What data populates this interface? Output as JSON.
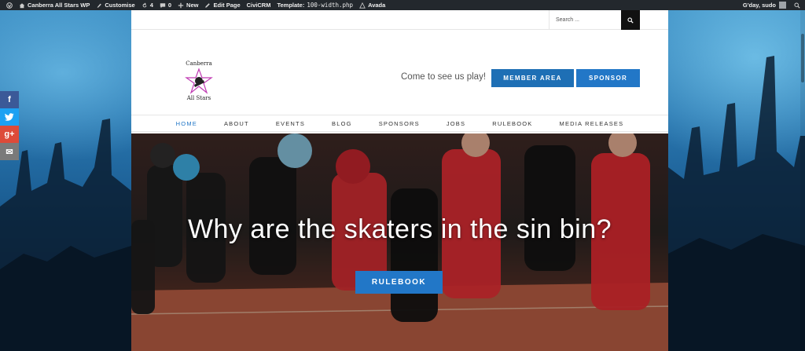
{
  "adminbar": {
    "site_name": "Canberra All Stars WP",
    "customise": "Customise",
    "updates_count": "4",
    "comments_count": "0",
    "new_label": "New",
    "edit_page": "Edit Page",
    "civicrm": "CiviCRM",
    "template_label": "Template:",
    "template_file": "100-width.php",
    "theme": "Avada",
    "greeting": "G'day, sudo"
  },
  "search": {
    "placeholder": "Search ..."
  },
  "header": {
    "logo_text_top": "Canberra",
    "logo_text_bottom": "All Stars",
    "tagline": "Come to see us play!",
    "member_button": "MEMBER AREA",
    "sponsor_button": "SPONSOR"
  },
  "nav": {
    "items": [
      {
        "label": "HOME"
      },
      {
        "label": "ABOUT"
      },
      {
        "label": "EVENTS"
      },
      {
        "label": "BLOG"
      },
      {
        "label": "SPONSORS"
      },
      {
        "label": "JOBS"
      },
      {
        "label": "RULEBOOK"
      },
      {
        "label": "MEDIA RELEASES"
      }
    ]
  },
  "hero": {
    "title": "Why are the skaters in the sin bin?",
    "button": "RULEBOOK"
  },
  "social": {
    "facebook": "f",
    "twitter": "t",
    "google": "g+",
    "email": "✉"
  },
  "colors": {
    "accent": "#2277c7",
    "adminbar": "#23282d",
    "facebook": "#3b5998",
    "twitter": "#1da1f2",
    "google": "#dd4b39",
    "email": "#7a7a7a"
  }
}
